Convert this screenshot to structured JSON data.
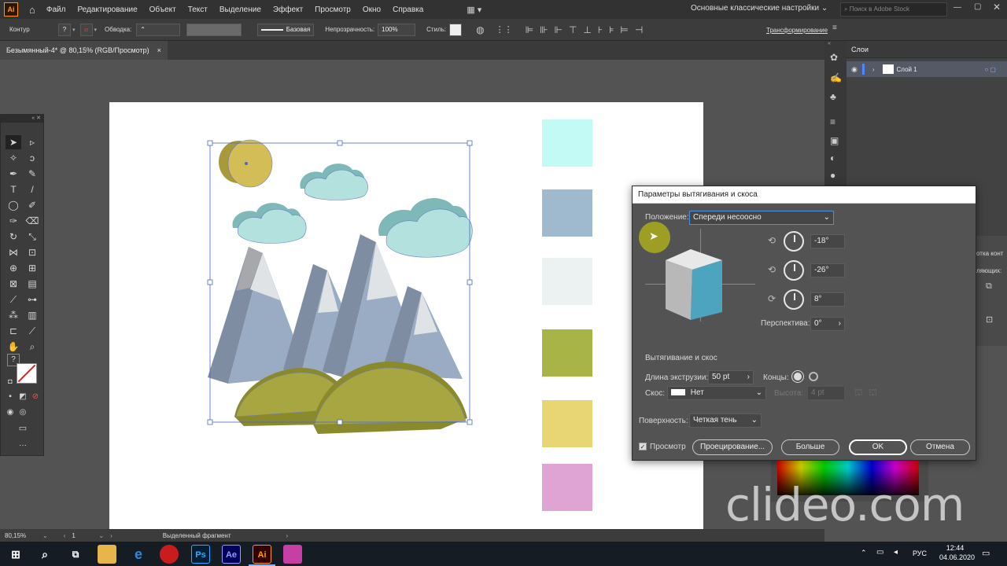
{
  "app": {
    "logo": "Ai",
    "menu": [
      "Файл",
      "Редактирование",
      "Объект",
      "Текст",
      "Выделение",
      "Эффект",
      "Просмотр",
      "Окно",
      "Справка"
    ],
    "workspace": "Основные классические настройки",
    "search_placeholder": "Поиск в Adobe Stock"
  },
  "controlbar": {
    "mode": "Контур",
    "stroke_label": "Обводка:",
    "brush": "Базовая",
    "opacity_label": "Непрозрачность:",
    "opacity_value": "100%",
    "style_label": "Стиль:",
    "transform": "Трансформирование"
  },
  "document": {
    "tab_title": "Безымянный-4* @ 80,15% (RGB/Просмотр)",
    "tab_close": "×"
  },
  "layers": {
    "panel_title": "Слои",
    "layer_name": "Слой 1"
  },
  "side_panel_partial": {
    "label1": "отка конт",
    "label2": "ляющих:"
  },
  "swatches": [
    "#c4faf6",
    "#9fb9cf",
    "#ecf1f1",
    "#a8b446",
    "#e8d574",
    "#e0a4d4"
  ],
  "dialog": {
    "title": "Параметры вытягивания и скоса",
    "position_label": "Положение:",
    "position_value": "Спереди несоосно",
    "rot_x": "-18°",
    "rot_y": "-26°",
    "rot_z": "8°",
    "perspective_label": "Перспектива:",
    "perspective_value": "0°",
    "extrude_section": "Вытягивание и скос",
    "depth_label": "Длина экструзии:",
    "depth_value": "50 pt",
    "caps_label": "Концы:",
    "bevel_label": "Скос:",
    "bevel_value": "Нет",
    "height_label": "Высота:",
    "height_value": "4 pt",
    "surface_label": "Поверхность:",
    "surface_value": "Четкая тень",
    "preview_label": "Просмотр",
    "map_button": "Проецирование...",
    "more_button": "Больше",
    "ok_button": "OK",
    "cancel_button": "Отмена"
  },
  "statusbar": {
    "zoom": "80,15%",
    "page": "1",
    "selection": "Выделенный фрагмент"
  },
  "taskbar": {
    "icons": [
      "Ps",
      "Ae",
      "Ai"
    ],
    "lang": "РУС",
    "time": "12:44",
    "date": "04.06.2020"
  },
  "watermark": "clideo.com"
}
